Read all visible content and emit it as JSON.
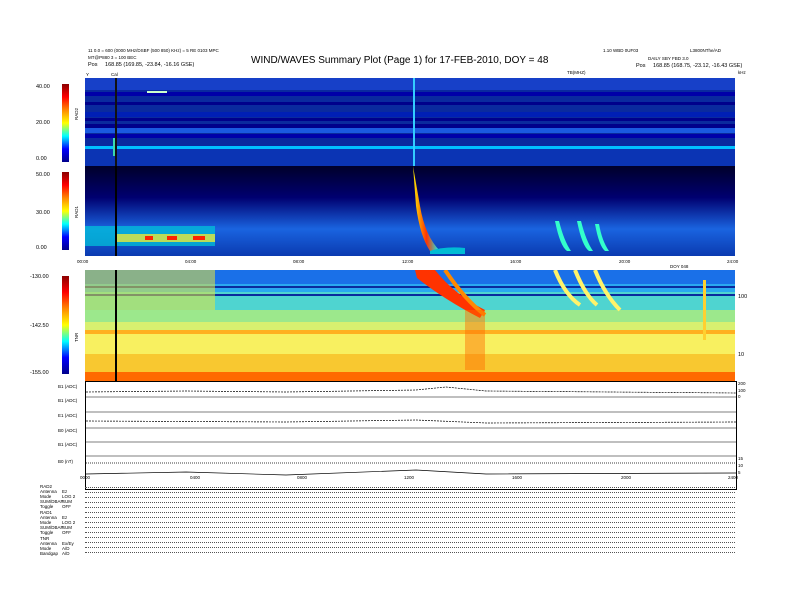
{
  "header": {
    "title": "WIND/WAVES Summary Plot (Page 1) for 17-FEB-2010, DOY = 48",
    "top_left_line1": "11 0.0 = 600 (0000 MHz/DSBF (500 850) KHz) = 5 RE 0103 MPC",
    "top_left_line2": "MT@P880 3 = 100 BEC",
    "top_left_pos_label": "Pos",
    "top_left_pos": "168.85 (169.85, -23.84, -16.16 GSE)",
    "top_right_line1": "1.10 WBD 0UF03",
    "top_right_line1b": "L3800NThe/AD",
    "top_right_line2": "DAILY SBY FBD 3.0",
    "top_right_pos_label": "Pos",
    "top_right_pos": "168.85 (168.75, -23.12, -16.43 GSE)",
    "label_y": "Y",
    "label_cal": "Cal",
    "label_tb": "TB(MHZ)",
    "label_mhz": "kHz"
  },
  "panels": {
    "rad2": {
      "label": "RAD2",
      "ticks": [
        "40.00",
        "20.00",
        "0.00"
      ]
    },
    "rad1": {
      "label": "RAD1",
      "ticks": [
        "50.00",
        "30.00",
        "0.00"
      ]
    },
    "tnr": {
      "label": "TNR",
      "ticks": [
        "-130.00",
        "-142.50",
        "-155.00"
      ],
      "right_ticks": [
        "100",
        "10"
      ]
    },
    "time_axis_top": [
      "00:00",
      "04:00",
      "08:00",
      "12:00",
      "16:00",
      "20:00",
      "24:00"
    ],
    "time_label_top": "DOY 048"
  },
  "line_plots": [
    {
      "label": "B1 (ADC)",
      "rticks": [
        "200",
        "100",
        "0"
      ]
    },
    {
      "label": "B1 (ADC)",
      "rticks": [
        "200",
        "100",
        "0"
      ]
    },
    {
      "label": "E1 (ADC)",
      "rticks": [
        "200",
        "100",
        "0"
      ]
    },
    {
      "label": "B0 (ADC)",
      "rticks": [
        "200",
        "100",
        "0"
      ]
    },
    {
      "label": "B1 (ADC)",
      "rticks": [
        "200",
        "100",
        "0"
      ]
    },
    {
      "label": "B0 (nT)",
      "rticks": [
        "15",
        "10",
        "5"
      ]
    }
  ],
  "time_axis_bottom": [
    "0000",
    "0400",
    "0800",
    "1200",
    "1600",
    "2000",
    "2400"
  ],
  "footer": {
    "rows": [
      [
        "RAD2",
        ""
      ],
      [
        "Antenna",
        "Ez"
      ],
      [
        "Mode",
        "LOG 2"
      ],
      [
        "SUM/DBAP",
        "SUM"
      ],
      [
        "Toggle",
        "OFF"
      ],
      [
        "RAD1",
        ""
      ],
      [
        "Antenna",
        "Ez"
      ],
      [
        "Mode",
        "LOG 2"
      ],
      [
        "SUM/DBAP",
        "SUM"
      ],
      [
        "Toggle",
        "OFF"
      ],
      [
        "TNR",
        ""
      ],
      [
        "Antenna",
        "Ex/Ey"
      ],
      [
        "Mode",
        "A/D"
      ],
      [
        "Bandgap",
        "A/D"
      ]
    ]
  }
}
